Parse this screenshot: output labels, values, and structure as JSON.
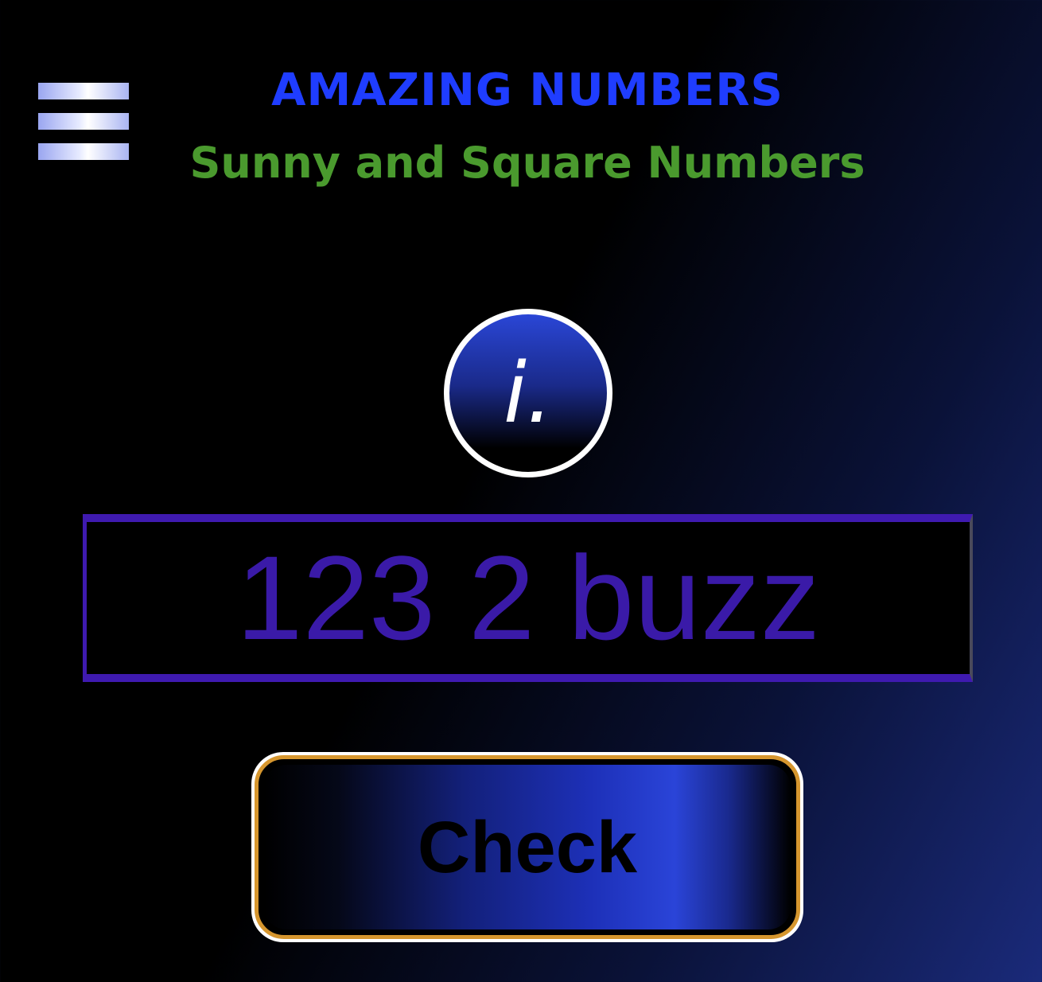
{
  "header": {
    "menu_icon": "hamburger-menu-icon",
    "title": "AMAZING NUMBERS",
    "subtitle": "Sunny and Square Numbers"
  },
  "info_button": {
    "icon": "info-icon",
    "glyph": "i."
  },
  "number_input": {
    "value": "123 2 buzz"
  },
  "check_button": {
    "label": "Check"
  },
  "colors": {
    "title": "#1f3dff",
    "subtitle": "#4a9a2e",
    "input_text": "#3a1aa8",
    "input_border": "#3f1ab0",
    "button_border": "#d6962e",
    "button_gradient_accent": "#2a44d8"
  }
}
